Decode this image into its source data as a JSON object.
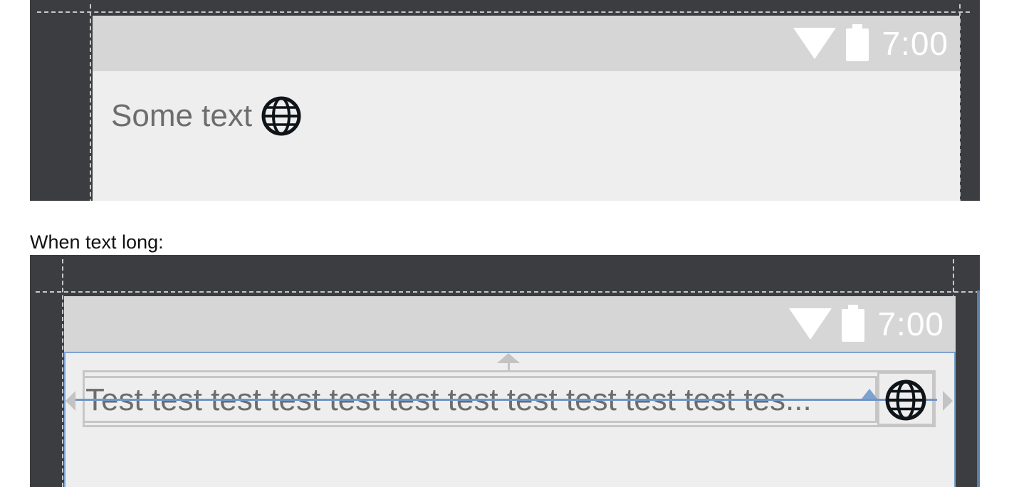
{
  "panel1": {
    "status_bar": {
      "time": "7:00",
      "wifi_icon": "wifi-icon",
      "battery_icon": "battery-icon"
    },
    "content": {
      "text": "Some text",
      "icon": "globe-icon"
    }
  },
  "caption": "When text long:",
  "panel2": {
    "status_bar": {
      "time": "7:00",
      "wifi_icon": "wifi-icon",
      "battery_icon": "battery-icon"
    },
    "content": {
      "text": "Test test test test test test test test test test test tes...",
      "icon": "globe-icon"
    }
  },
  "colors": {
    "editor_background": "#3b3d40",
    "status_bar": "#d6d6d6",
    "screen_background": "#eeeeee",
    "selection_blue": "#7ea2cf",
    "text_grey": "#6d6d6d"
  }
}
